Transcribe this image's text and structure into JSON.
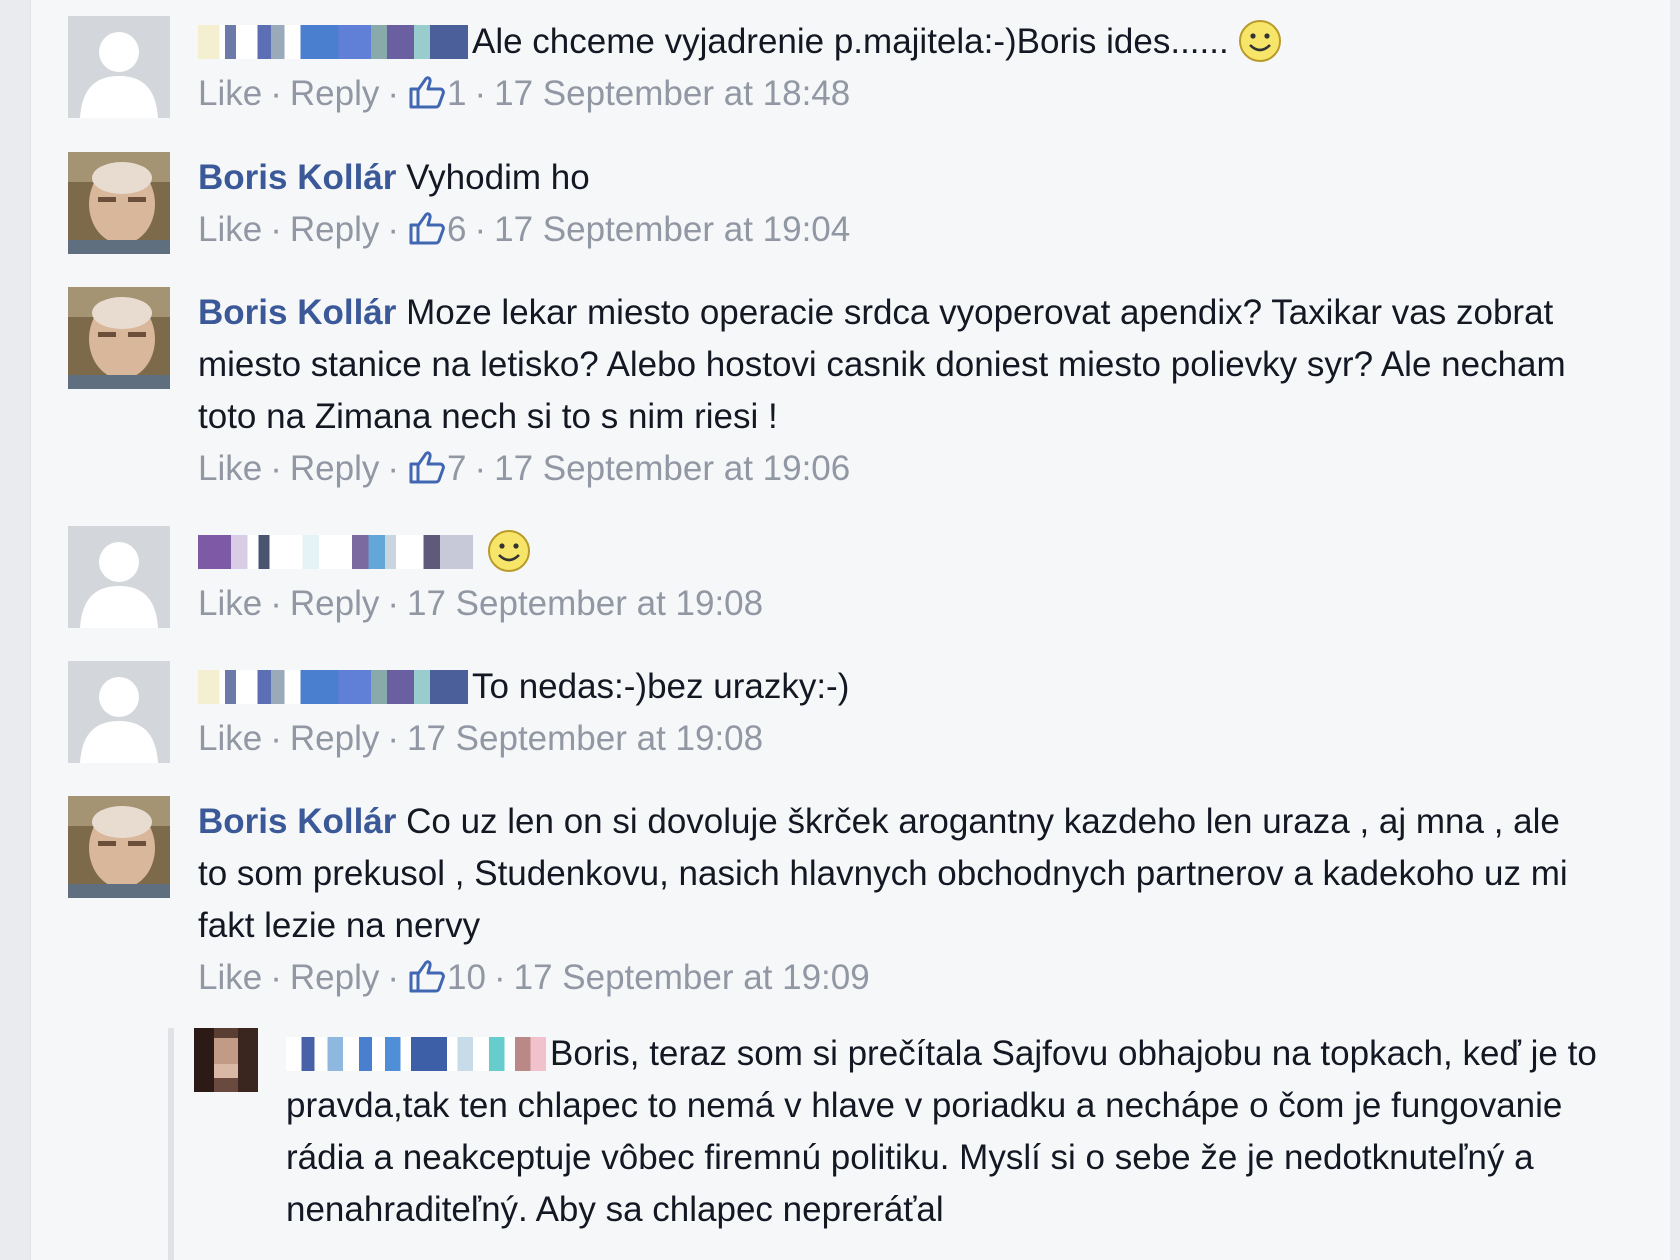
{
  "comments": [
    {
      "author": "",
      "text": "Ale chceme vyjadrenie p.majitela:-)Boris ides......",
      "has_smiley": true,
      "actions": {
        "like": "Like",
        "reply": "Reply",
        "likes": "1",
        "time": "17 September at 18:48"
      }
    },
    {
      "author": "Boris Kollár",
      "text": "Vyhodim ho",
      "actions": {
        "like": "Like",
        "reply": "Reply",
        "likes": "6",
        "time": "17 September at 19:04"
      }
    },
    {
      "author": "Boris Kollár",
      "text": "Moze lekar miesto operacie srdca vyoperovat apendix? Taxikar vas zobrat miesto stanice na letisko? Alebo hostovi casnik doniest miesto polievky syr? Ale necham toto na Zimana nech si to s nim riesi !",
      "actions": {
        "like": "Like",
        "reply": "Reply",
        "likes": "7",
        "time": "17 September at 19:06"
      }
    },
    {
      "author": "",
      "text": "",
      "has_smiley": true,
      "actions": {
        "like": "Like",
        "reply": "Reply",
        "likes": "",
        "time": "17 September at 19:08"
      }
    },
    {
      "author": "",
      "text": "To nedas:-)bez urazky:-)",
      "actions": {
        "like": "Like",
        "reply": "Reply",
        "likes": "",
        "time": "17 September at 19:08"
      }
    },
    {
      "author": "Boris Kollár",
      "text": "Co uz len on si dovoluje škrček arogantny kazdeho len uraza , aj mna , ale to som prekusol , Studenkovu, nasich hlavnych obchodnych partnerov a kadekoho uz mi fakt lezie na nervy",
      "actions": {
        "like": "Like",
        "reply": "Reply",
        "likes": "10",
        "time": "17 September at 19:09"
      }
    }
  ],
  "reply": {
    "author": "",
    "text": "Boris, teraz som si prečítala Sajfovu obhajobu na topkach, keď je to pravda,tak ten chlapec to nemá v hlave v poriadku a nechápe o čom je fungovanie rádia a neakceptuje vôbec firemnú politiku. Myslí si o sebe že je nedotknuteľný a nenahraditeľný. Aby sa chlapec nepreráťal"
  },
  "colors": {
    "name": "#3b5998",
    "meta": "#9197a3",
    "background": "#f6f7f9"
  },
  "icons": [
    "default-avatar-icon",
    "profile-photo",
    "thumbs-up-icon",
    "smiley-emoji-icon"
  ]
}
